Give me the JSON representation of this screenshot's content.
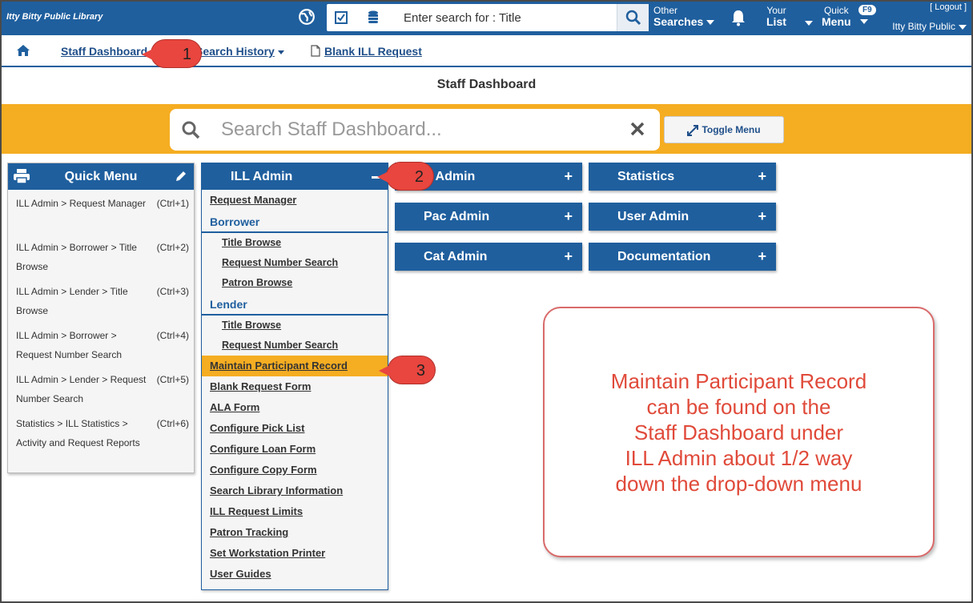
{
  "topbar": {
    "brand": "Itty Bitty Public Library",
    "search_placeholder": "Enter search for : Title",
    "other_searches_line1": "Other",
    "other_searches_line2": "Searches",
    "your_list_line1": "Your",
    "your_list_line2": "List",
    "quick_menu_line1": "Quick",
    "quick_menu_line2": "Menu",
    "quick_menu_key": "F9",
    "logout": "[ Logout ]",
    "library": "Itty Bitty Public"
  },
  "nav": {
    "staff_dashboard": "Staff Dashboard",
    "search_history": "Search History",
    "blank_ill_request": "Blank ILL Request"
  },
  "callouts": {
    "c1": "1",
    "c2": "2",
    "c3": "3"
  },
  "page_title": "Staff Dashboard",
  "dashboard_search": {
    "placeholder": "Search Staff Dashboard...",
    "toggle_label": "Toggle Menu"
  },
  "quick_menu": {
    "title": "Quick Menu",
    "items": [
      {
        "label": "ILL Admin > Request Manager",
        "key": "(Ctrl+1)"
      },
      {
        "label": "ILL Admin > Borrower > Title Browse",
        "key": "(Ctrl+2)"
      },
      {
        "label": "ILL Admin > Lender > Title Browse",
        "key": "(Ctrl+3)"
      },
      {
        "label": "ILL Admin > Borrower > Request Number Search",
        "key": "(Ctrl+4)"
      },
      {
        "label": "ILL Admin > Lender > Request Number Search",
        "key": "(Ctrl+5)"
      },
      {
        "label": "Statistics > ILL Statistics > Activity and Request Reports",
        "key": "(Ctrl+6)"
      }
    ]
  },
  "ill_admin": {
    "title": "ILL Admin",
    "request_manager": "Request Manager",
    "borrower": "Borrower",
    "borrower_items": [
      "Title Browse",
      "Request Number Search",
      "Patron Browse"
    ],
    "lender": "Lender",
    "lender_items": [
      "Title Browse",
      "Request Number Search"
    ],
    "links": [
      "Maintain Participant Record",
      "Blank Request Form",
      "ALA Form",
      "Configure Pick List",
      "Configure Loan Form",
      "Configure Copy Form",
      "Search Library Information",
      "ILL Request Limits",
      "Patron Tracking",
      "Set Workstation Printer",
      "User Guides"
    ]
  },
  "tiles": {
    "x_admin": "X Admin",
    "statistics": "Statistics",
    "pac_admin": "Pac Admin",
    "user_admin": "User Admin",
    "cat_admin": "Cat Admin",
    "documentation": "Documentation"
  },
  "note": "Maintain Participant Record\ncan be found on the\nStaff Dashboard under\nILL Admin about 1/2 way\ndown the drop-down menu"
}
